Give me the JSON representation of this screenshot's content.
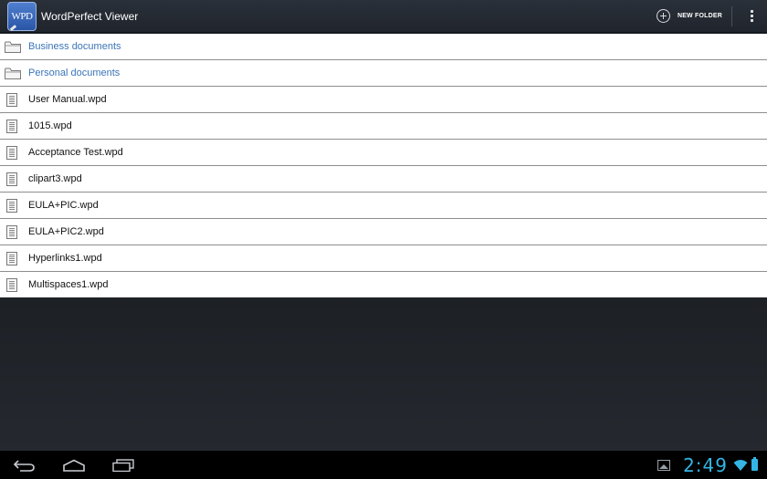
{
  "app": {
    "title": "WordPerfect Viewer",
    "icon_text": "WPD",
    "icon": "wpd-app-icon"
  },
  "action_bar": {
    "new_folder_label": "NEW FOLDER",
    "new_folder_icon": "add-circle-icon",
    "overflow_icon": "overflow-menu-icon"
  },
  "folders": [
    {
      "name": "Business documents",
      "icon": "folder-icon"
    },
    {
      "name": "Personal documents",
      "icon": "folder-icon"
    }
  ],
  "files": [
    {
      "name": "User Manual.wpd",
      "icon": "document-icon"
    },
    {
      "name": "1015.wpd",
      "icon": "document-icon"
    },
    {
      "name": "Acceptance Test.wpd",
      "icon": "document-icon"
    },
    {
      "name": "clipart3.wpd",
      "icon": "document-icon"
    },
    {
      "name": "EULA+PIC.wpd",
      "icon": "document-icon"
    },
    {
      "name": "EULA+PIC2.wpd",
      "icon": "document-icon"
    },
    {
      "name": "Hyperlinks1.wpd",
      "icon": "document-icon"
    },
    {
      "name": "Multispaces1.wpd",
      "icon": "document-icon"
    }
  ],
  "system_bar": {
    "clock": "2:49",
    "nav_icons": [
      "back-icon",
      "home-icon",
      "recent-apps-icon"
    ],
    "status_icons": [
      "gallery-notification-icon",
      "wifi-icon",
      "battery-icon"
    ]
  },
  "colors": {
    "action_bar": "#252a32",
    "folder_text": "#3a75b9",
    "clock": "#34b5e5",
    "background_dark": "#1f232a"
  }
}
